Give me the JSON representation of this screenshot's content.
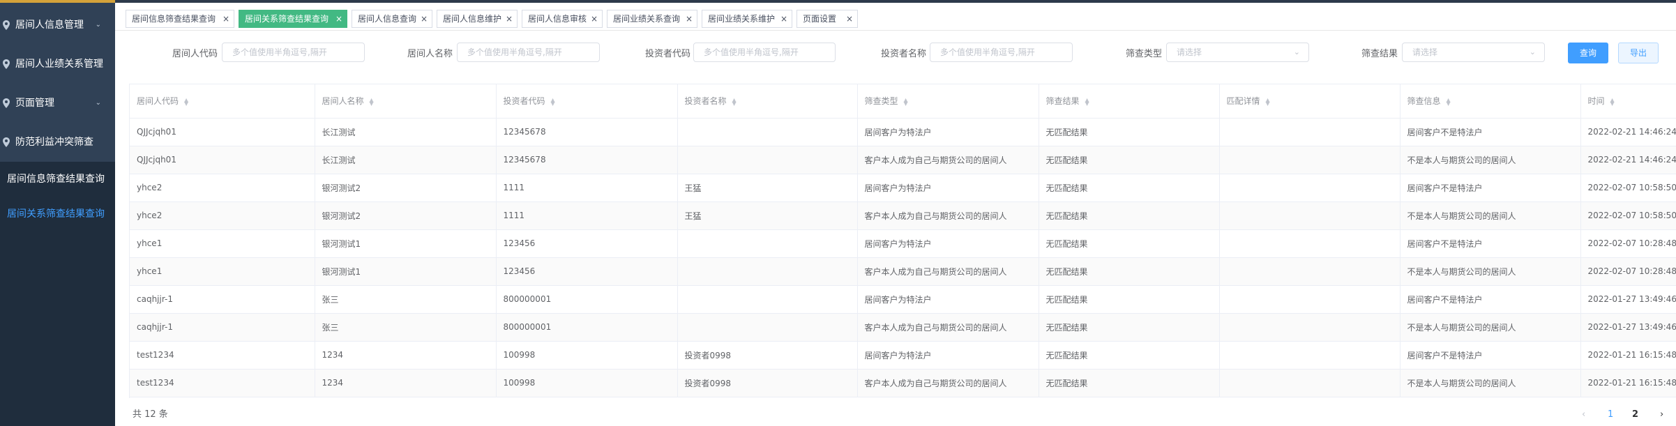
{
  "sidebar": {
    "items": [
      {
        "label": "居间人信息管理"
      },
      {
        "label": "居间人业绩关系管理"
      },
      {
        "label": "页面管理"
      },
      {
        "label": "防范利益冲突筛查"
      }
    ],
    "subitems": [
      {
        "label": "居间信息筛查结果查询"
      },
      {
        "label": "居间关系筛查结果查询"
      }
    ]
  },
  "tabs": [
    {
      "label": "居间信息筛查结果查询"
    },
    {
      "label": "居间关系筛查结果查询"
    },
    {
      "label": "居间人信息查询"
    },
    {
      "label": "居间人信息维护"
    },
    {
      "label": "居间人信息审核"
    },
    {
      "label": "居间业绩关系查询"
    },
    {
      "label": "居间业绩关系维护"
    },
    {
      "label": "页面设置"
    }
  ],
  "filters": {
    "agent_code": {
      "label": "居间人代码",
      "placeholder": "多个值使用半角逗号,隔开"
    },
    "agent_name": {
      "label": "居间人名称",
      "placeholder": "多个值使用半角逗号,隔开"
    },
    "investor_code": {
      "label": "投资者代码",
      "placeholder": "多个值使用半角逗号,隔开"
    },
    "investor_name": {
      "label": "投资者名称",
      "placeholder": "多个值使用半角逗号,隔开"
    },
    "screen_type": {
      "label": "筛查类型",
      "placeholder": "请选择"
    },
    "screen_result": {
      "label": "筛查结果",
      "placeholder": "请选择"
    },
    "query_label": "查询",
    "export_label": "导出"
  },
  "table": {
    "columns": [
      "居间人代码",
      "居间人名称",
      "投资者代码",
      "投资者名称",
      "筛查类型",
      "筛查结果",
      "匹配详情",
      "筛查信息",
      "时间"
    ],
    "rows": [
      [
        "QJJcjqh01",
        "长江测试",
        "12345678",
        "",
        "居间客户为特法户",
        "无匹配结果",
        "",
        "居间客户不是特法户",
        "2022-02-21 14:46:24"
      ],
      [
        "QJJcjqh01",
        "长江测试",
        "12345678",
        "",
        "客户本人成为自己与期货公司的居间人",
        "无匹配结果",
        "",
        "不是本人与期货公司的居间人",
        "2022-02-21 14:46:24"
      ],
      [
        "yhce2",
        "银河测试2",
        "1111",
        "王猛",
        "居间客户为特法户",
        "无匹配结果",
        "",
        "居间客户不是特法户",
        "2022-02-07 10:58:50"
      ],
      [
        "yhce2",
        "银河测试2",
        "1111",
        "王猛",
        "客户本人成为自己与期货公司的居间人",
        "无匹配结果",
        "",
        "不是本人与期货公司的居间人",
        "2022-02-07 10:58:50"
      ],
      [
        "yhce1",
        "银河测试1",
        "123456",
        "",
        "居间客户为特法户",
        "无匹配结果",
        "",
        "居间客户不是特法户",
        "2022-02-07 10:28:48"
      ],
      [
        "yhce1",
        "银河测试1",
        "123456",
        "",
        "客户本人成为自己与期货公司的居间人",
        "无匹配结果",
        "",
        "不是本人与期货公司的居间人",
        "2022-02-07 10:28:48"
      ],
      [
        "caqhjjr-1",
        "张三",
        "800000001",
        "",
        "居间客户为特法户",
        "无匹配结果",
        "",
        "居间客户不是特法户",
        "2022-01-27 13:49:46"
      ],
      [
        "caqhjjr-1",
        "张三",
        "800000001",
        "",
        "客户本人成为自己与期货公司的居间人",
        "无匹配结果",
        "",
        "不是本人与期货公司的居间人",
        "2022-01-27 13:49:46"
      ],
      [
        "test1234",
        "1234",
        "100998",
        "投资者0998",
        "居间客户为特法户",
        "无匹配结果",
        "",
        "居间客户不是特法户",
        "2022-01-21 16:15:48"
      ],
      [
        "test1234",
        "1234",
        "100998",
        "投资者0998",
        "客户本人成为自己与期货公司的居间人",
        "无匹配结果",
        "",
        "不是本人与期货公司的居间人",
        "2022-01-21 16:15:48"
      ]
    ]
  },
  "footer": {
    "total": "共 12 条",
    "pages": [
      "1",
      "2"
    ],
    "current_page": "1"
  },
  "colors": {
    "sidebar_bg": "#304156",
    "sidebar_sub_bg": "#1f2d3d",
    "active_tab": "#42b983",
    "primary": "#409eff",
    "accent": "#d4a23a"
  },
  "icons": {
    "sidebar_item": "location-pin-icon",
    "chevron": "chevron-down-icon",
    "tab_close": "close-icon",
    "sort": "sort-caret-icon",
    "select_arrow": "chevron-down-icon",
    "page_prev": "chevron-left-icon",
    "page_next": "chevron-right-icon"
  }
}
